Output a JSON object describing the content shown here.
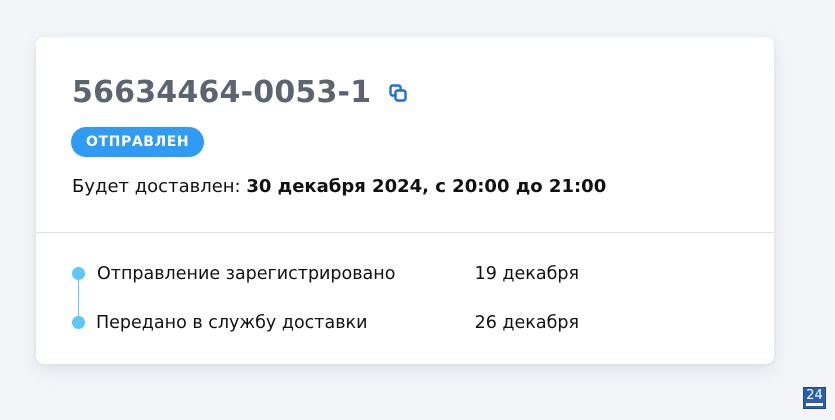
{
  "order": {
    "number": "56634464-0053-1",
    "status": "ОТПРАВЛЕН",
    "delivery_prefix": "Будет доставлен: ",
    "delivery_date": "30 декабря 2024, с 20:00 до 21:00"
  },
  "timeline": [
    {
      "label": "Отправление зарегистрировано",
      "date": "19 декабря"
    },
    {
      "label": "Передано в службу доставки",
      "date": "26 декабря"
    }
  ],
  "colors": {
    "accent": "#2f9bf4",
    "timeline": "#5ec7f6",
    "copy_icon": "#1f6fe0",
    "order_number": "#5b6470"
  },
  "icons": {
    "copy": "copy-icon"
  },
  "page_badge": "24"
}
